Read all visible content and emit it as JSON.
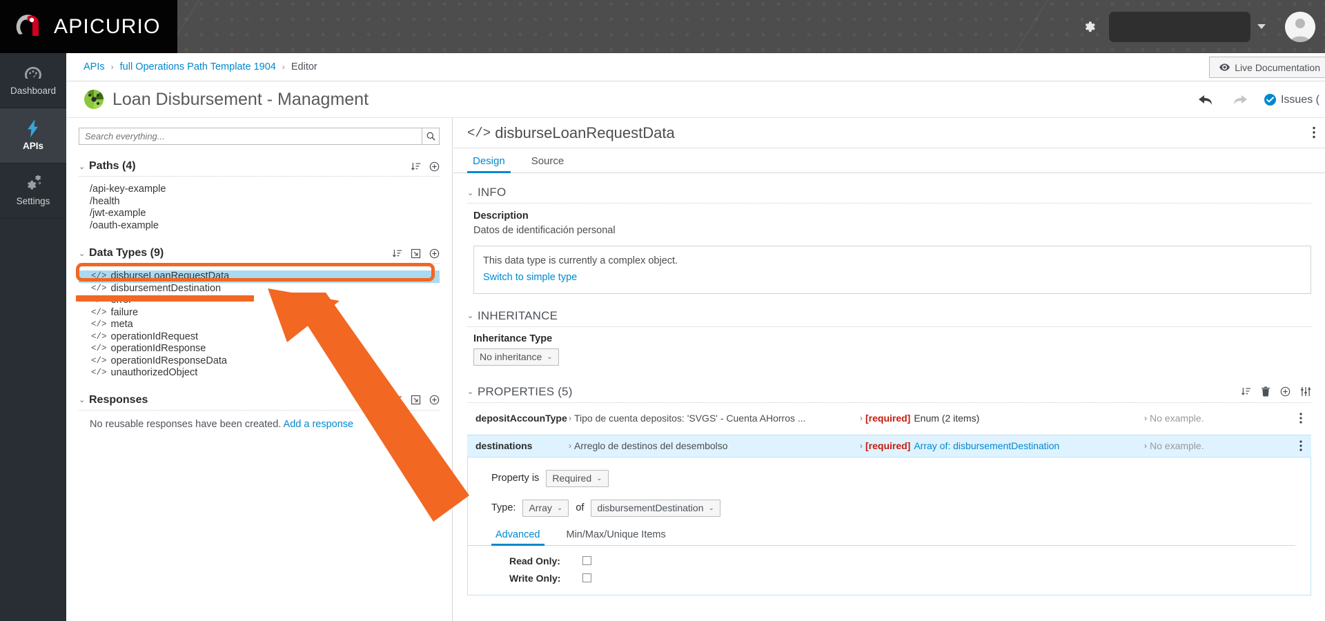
{
  "brand": {
    "name": "APICURIO"
  },
  "topbar": {
    "gear_icon": "gear-icon",
    "user_caret_icon": "chevron-down-icon",
    "avatar_icon": "user-avatar-icon"
  },
  "rail": {
    "items": [
      {
        "label": "Dashboard",
        "icon": "dashboard-gauge-icon",
        "active": false
      },
      {
        "label": "APIs",
        "icon": "lightning-bolt-icon",
        "active": true
      },
      {
        "label": "Settings",
        "icon": "gears-icon",
        "active": false
      }
    ]
  },
  "breadcrumb": {
    "items": [
      {
        "label": "APIs",
        "link": true
      },
      {
        "label": "full Operations Path Template 1904",
        "link": true
      },
      {
        "label": "Editor",
        "link": false
      }
    ],
    "separator": "›",
    "live_documentation_label": "Live Documentation",
    "live_documentation_icon": "eye-icon"
  },
  "title_bar": {
    "title": "Loan Disbursement - Managment",
    "icon": "api-palette-icon",
    "undo_icon": "undo-arrow-icon",
    "redo_icon": "redo-arrow-icon",
    "issues_label": "Issues (",
    "issues_icon": "check-circle-icon"
  },
  "left_panel": {
    "search": {
      "placeholder": "Search everything...",
      "value": "",
      "icon": "search-icon"
    },
    "sections": [
      {
        "title": "Paths (4)",
        "tools": [
          "sort-icon",
          "add-circle-icon"
        ],
        "items": [
          {
            "label": "/api-key-example"
          },
          {
            "label": "/health"
          },
          {
            "label": "/jwt-example"
          },
          {
            "label": "/oauth-example"
          }
        ]
      },
      {
        "title": "Data Types (9)",
        "tools": [
          "sort-icon",
          "import-icon",
          "add-circle-icon"
        ],
        "items": [
          {
            "label": "disburseLoanRequestData",
            "icon": "code-tag-icon",
            "selected": true
          },
          {
            "label": "disbursementDestination",
            "icon": "code-tag-icon",
            "selected": false
          },
          {
            "label": "error",
            "icon": "code-tag-icon",
            "selected": false
          },
          {
            "label": "failure",
            "icon": "code-tag-icon",
            "selected": false
          },
          {
            "label": "meta",
            "icon": "code-tag-icon",
            "selected": false
          },
          {
            "label": "operationIdRequest",
            "icon": "code-tag-icon",
            "selected": false
          },
          {
            "label": "operationIdResponse",
            "icon": "code-tag-icon",
            "selected": false
          },
          {
            "label": "operationIdResponseData",
            "icon": "code-tag-icon",
            "selected": false
          },
          {
            "label": "unauthorizedObject",
            "icon": "code-tag-icon",
            "selected": false
          }
        ]
      },
      {
        "title": "Responses",
        "tools": [
          "sort-icon",
          "import-icon",
          "add-circle-icon"
        ],
        "empty_text": "No reusable responses have been created.",
        "empty_link": "Add a response",
        "items": []
      }
    ]
  },
  "right_panel": {
    "header_title": "disburseLoanRequestData",
    "header_icon": "code-tag-icon",
    "kebab_icon": "kebab-menu-icon",
    "tabs": [
      {
        "label": "Design",
        "active": true
      },
      {
        "label": "Source",
        "active": false
      }
    ],
    "info": {
      "section_label": "INFO",
      "description_label": "Description",
      "description_value": "Datos de identificación personal",
      "alert_text": "This data type is currently a complex object.",
      "alert_link": "Switch to simple type"
    },
    "inheritance": {
      "section_label": "INHERITANCE",
      "type_label": "Inheritance Type",
      "type_value": "No inheritance"
    },
    "properties": {
      "section_label": "PROPERTIES (5)",
      "tools": [
        "sort-icon",
        "trash-icon",
        "add-circle-icon",
        "sliders-icon"
      ],
      "no_example_label": "No example.",
      "rows": [
        {
          "name": "depositAccounType",
          "description": "Tipo de cuenta depositos: 'SVGS' - Cuenta AHorros ...",
          "required_tag": "[required]",
          "type": "Enum (2 items)",
          "type_is_link": false,
          "example": "No example.",
          "selected": false
        },
        {
          "name": "destinations",
          "description": "Arreglo de destinos del desembolso",
          "required_tag": "[required]",
          "type": "Array of: disbursementDestination",
          "type_is_link": true,
          "example": "No example.",
          "selected": true
        }
      ],
      "editor": {
        "property_is_label": "Property is",
        "property_is_value": "Required",
        "type_label": "Type:",
        "type_value": "Array",
        "of_label": "of",
        "of_value": "disbursementDestination",
        "tabs": [
          {
            "label": "Advanced",
            "active": true
          },
          {
            "label": "Min/Max/Unique Items",
            "active": false
          }
        ],
        "read_only_label": "Read Only:",
        "read_only_checked": false,
        "write_only_label": "Write Only:",
        "write_only_checked": false
      }
    }
  },
  "annotations": {
    "highlight_color": "#f26722",
    "box_target": "disburseLoanRequestData",
    "bar_target": "disbursementDestination",
    "arrow_points_to": "data-types-list"
  },
  "colors": {
    "accent_blue": "#0088ce",
    "selection_blue": "#aadaf2",
    "row_selection": "#def3ff",
    "annotation_orange": "#f26722",
    "rail_bg": "#292e34",
    "brand_black": "#030303",
    "required_red": "#c9190b"
  }
}
